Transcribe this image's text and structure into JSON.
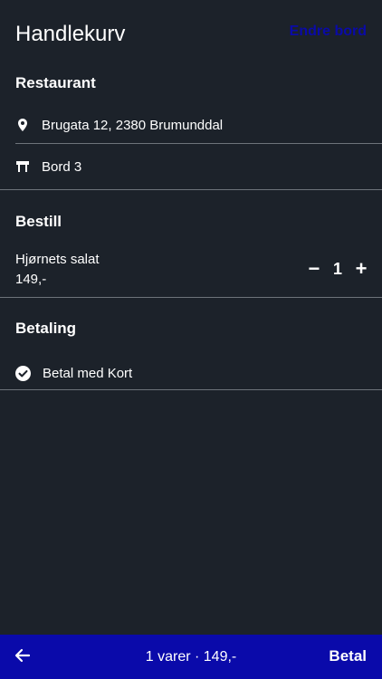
{
  "header": {
    "title": "Handlekurv",
    "change_table_label": "Endre bord"
  },
  "restaurant": {
    "section_title": "Restaurant",
    "address": "Brugata 12, 2380 Brumunddal",
    "address_icon": "location-pin-icon",
    "table": "Bord 3",
    "table_icon": "table-icon"
  },
  "order": {
    "section_title": "Bestill",
    "items": [
      {
        "name": "Hjørnets salat",
        "price": "149,-",
        "quantity": "1",
        "decrease_label": "−",
        "increase_label": "+"
      }
    ]
  },
  "payment": {
    "section_title": "Betaling",
    "method": "Betal med Kort",
    "method_icon": "check-circle-icon"
  },
  "bottom_bar": {
    "back_icon": "arrow-left-icon",
    "summary": "1 varer · 149,-",
    "pay_label": "Betal"
  },
  "colors": {
    "background": "#1c222a",
    "accent": "#0a0aaa",
    "link": "#0a0aa8",
    "divider": "#6d737a"
  }
}
